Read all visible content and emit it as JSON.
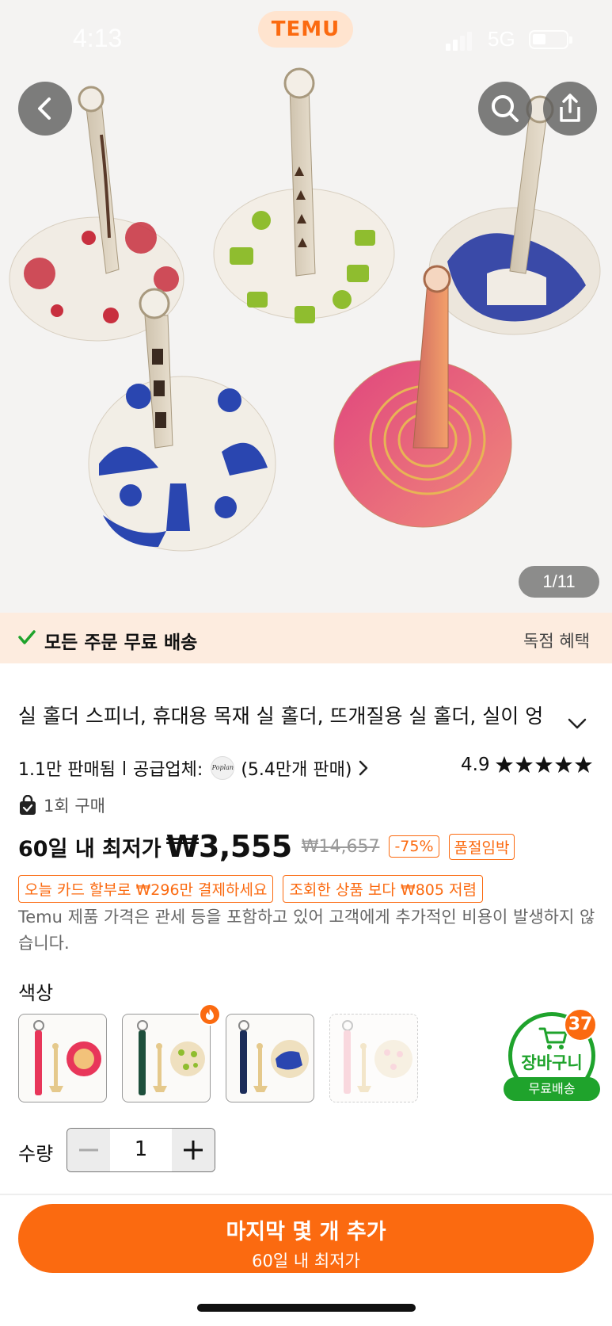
{
  "status_bar": {
    "time": "4:13",
    "network": "5G"
  },
  "header": {
    "logo": "TEMU"
  },
  "gallery": {
    "counter": "1/11"
  },
  "shipping_bar": {
    "text": "모든 주문 무료 배송",
    "right_label": "독점 혜택"
  },
  "product": {
    "title": "실 홀더 스피너, 휴대용 목재 실 홀더, 뜨개질용 실 홀더, 실이 엉",
    "sold": "1.1만 판매됨",
    "supplier_label": "공급업체:",
    "supplier_logo_text": "Poplan",
    "supplier_sales": "(5.4만개 판매)",
    "rating": "4.9",
    "rating_stars": 5,
    "purchase_note": "1회 구매"
  },
  "price": {
    "label": "60일 내 최저가",
    "current": "₩3,555",
    "original": "₩14,657",
    "discount": "-75%",
    "stock_tag": "품절임박",
    "promo_card": "오늘 카드 할부로 ₩296만 결제하세요",
    "promo_compare": "조회한 상품 보다 ₩805 저렴",
    "notice": "Temu 제품 가격은 관세 등을 포함하고 있어 고객에게 추가적인 비용이 발생하지 않습니다."
  },
  "color": {
    "label": "색상",
    "options": [
      {
        "name": "pink-strap",
        "accent": "#e8365a"
      },
      {
        "name": "green-strap",
        "accent": "#1e4f3c"
      },
      {
        "name": "navy-strap",
        "accent": "#1c2d5a"
      },
      {
        "name": "light-pink-strap",
        "accent": "#f2a9b8"
      }
    ]
  },
  "cart": {
    "label": "장바구니",
    "free": "무료배송",
    "count": "37"
  },
  "quantity": {
    "label": "수량",
    "value": "1"
  },
  "cta": {
    "main": "마지막 몇 개 추가",
    "sub": "60일 내 최저가"
  },
  "colors": {
    "accent": "#fb6a10",
    "green": "#1fa32c",
    "ship_bg": "#fdecdf"
  }
}
